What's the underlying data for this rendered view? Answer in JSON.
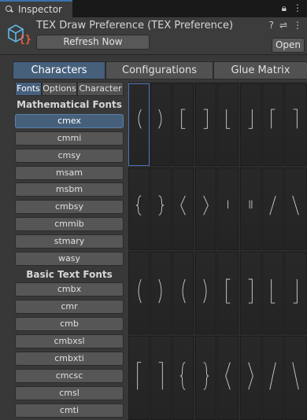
{
  "window": {
    "tab_label": "Inspector",
    "title": "TEX Draw Preference (TEX Preference)",
    "refresh_label": "Refresh Now",
    "open_label": "Open",
    "header_icons": [
      "help-icon",
      "settings-icon",
      "more-icon"
    ],
    "strip_icons": [
      "lock-icon",
      "more-icon"
    ]
  },
  "main_tabs": [
    "Characters",
    "Configurations",
    "Glue Matrix"
  ],
  "main_tab_active": "Characters",
  "sub_tabs": [
    "Fonts",
    "Options",
    "Character"
  ],
  "sub_tab_active": "Fonts",
  "sidebar": {
    "math_header": "Mathematical Fonts",
    "math_fonts": [
      "cmex",
      "cmmi",
      "cmsy",
      "msam",
      "msbm",
      "cmbsy",
      "cmmib",
      "stmary",
      "wasy"
    ],
    "selected_font": "cmex",
    "text_header": "Basic Text Fonts",
    "text_fonts": [
      "cmbx",
      "cmr",
      "cmb",
      "cmbxsl",
      "cmbxti",
      "cmcsc",
      "cmsl",
      "cmti"
    ]
  },
  "glyph_rows": [
    [
      "paren-left",
      "paren-right",
      "bracket-left",
      "bracket-right",
      "floor-left",
      "floor-right",
      "ceil-left",
      "ceil-right"
    ],
    [
      "brace-left",
      "brace-right",
      "angle-left",
      "angle-right",
      "vert-bar",
      "double-vert-bar",
      "slash",
      "backslash"
    ],
    [
      "paren-left",
      "paren-right",
      "paren-left",
      "paren-right",
      "bracket-left",
      "bracket-right",
      "floor-left",
      "floor-right"
    ],
    [
      "ceil-left",
      "ceil-right",
      "brace-left",
      "brace-right",
      "angle-left",
      "angle-right",
      "slash",
      "backslash"
    ]
  ],
  "selected_glyph": {
    "row": 0,
    "col": 0
  },
  "colors": {
    "accent": "#46607c",
    "selection_outline": "#4b74b8",
    "panel": "#383838",
    "tab_strip": "#191919"
  }
}
